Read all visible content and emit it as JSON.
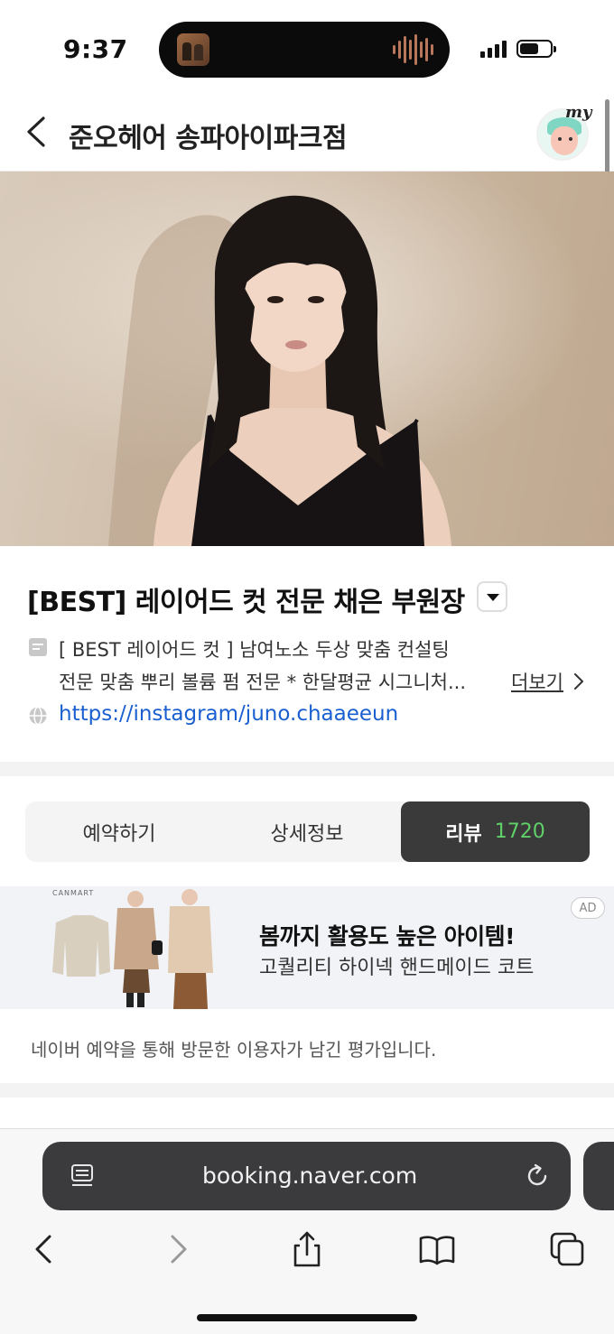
{
  "status_bar": {
    "time": "9:37"
  },
  "header": {
    "title": "준오헤어 송파아이파크점",
    "my_label": "my"
  },
  "designer": {
    "title": "[BEST] 레이어드 컷 전문 채은 부원장",
    "desc_line1": "[ BEST 레이어드 컷 ] 남여노소 두상 맞춤 컨설팅",
    "desc_line2": "전문 맞춤 뿌리 볼륨 펌 전문 * 한달평균 시그니처...",
    "more_label": "더보기",
    "url": "https://instagram/juno.chaaeeun"
  },
  "tabs": [
    {
      "label": "예약하기"
    },
    {
      "label": "상세정보"
    },
    {
      "label": "리뷰",
      "count": "1720"
    }
  ],
  "ad": {
    "brand": "CANMART",
    "headline": "봄까지 활용도 높은 아이템!",
    "sub": "고퀄리티 하이넥 핸드메이드 코트",
    "badge": "AD"
  },
  "review_note": "네이버 예약을 통해 방문한 이용자가 남긴 평가입니다.",
  "browser": {
    "url": "booking.naver.com"
  },
  "icons": {
    "back": "chevron-left-icon",
    "dropdown": "caret-down-icon",
    "desc": "memo-icon",
    "globe": "globe-icon",
    "reader": "reader-mode-icon",
    "reload": "reload-icon",
    "toolbar": [
      "back-icon",
      "forward-icon",
      "share-icon",
      "bookmarks-icon",
      "tabs-icon"
    ]
  },
  "colors": {
    "link": "#1a5fd0",
    "review_count": "#5fd068",
    "active_tab": "#3a3a3a"
  }
}
